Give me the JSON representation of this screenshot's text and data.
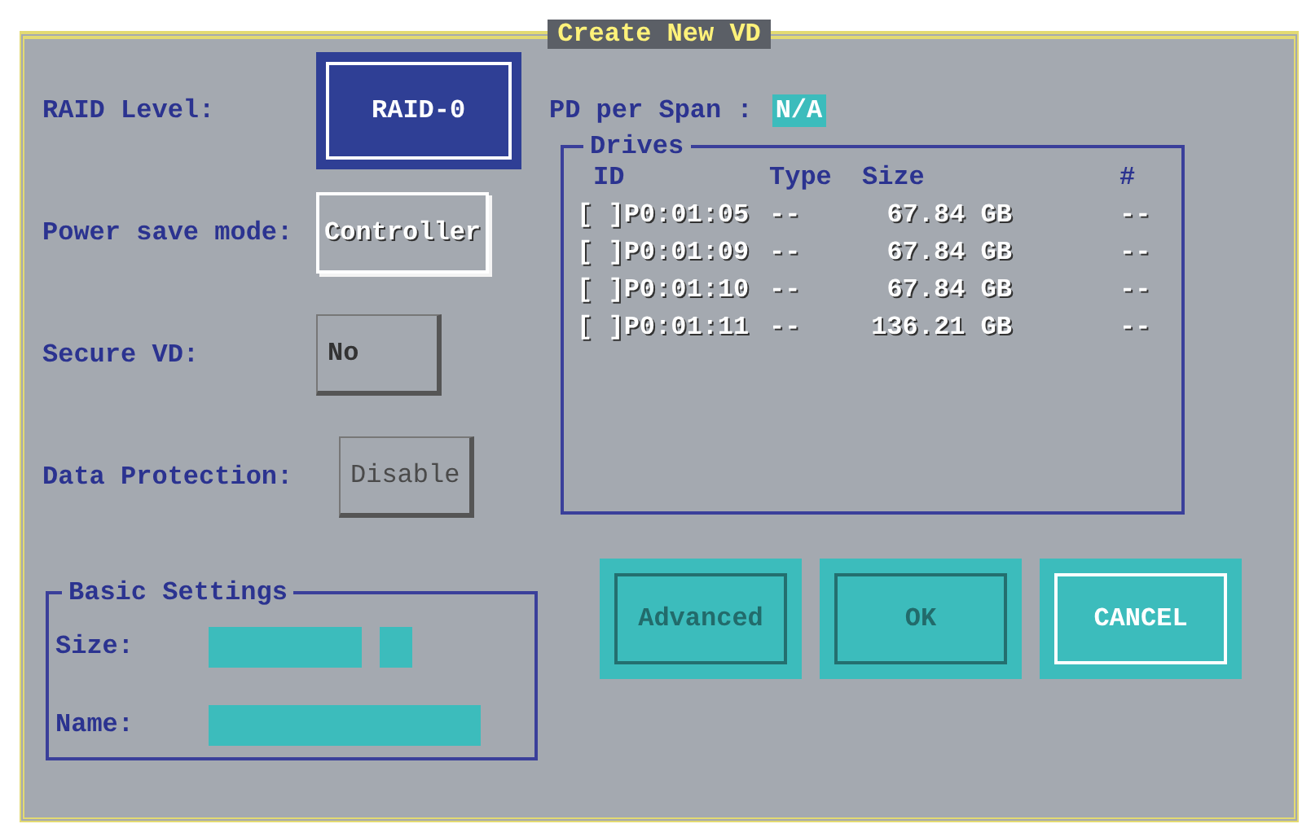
{
  "window": {
    "title": "Create New VD"
  },
  "settings": [
    {
      "label": "RAID Level:",
      "value": "RAID-0",
      "focused": true,
      "highlighted": false,
      "disabled": false
    },
    {
      "label": "Power save mode:",
      "value": "Controller",
      "focused": false,
      "highlighted": true,
      "disabled": false
    },
    {
      "label": "Secure VD:",
      "value": "No",
      "focused": false,
      "highlighted": false,
      "disabled": false
    },
    {
      "label": "Data Protection:",
      "value": "Disable",
      "focused": false,
      "highlighted": false,
      "disabled": true
    }
  ],
  "pd_per_span": {
    "label": "PD per Span :",
    "value": "N/A"
  },
  "drives": {
    "title": "Drives",
    "columns": [
      "ID",
      "Type",
      "Size",
      "#"
    ],
    "rows": [
      {
        "select": "[ ]",
        "checked": false,
        "id": "P0:01:05",
        "type": "--",
        "size": "67.84 GB",
        "number": "--"
      },
      {
        "select": "[ ]",
        "checked": false,
        "id": "P0:01:09",
        "type": "--",
        "size": "67.84 GB",
        "number": "--"
      },
      {
        "select": "[ ]",
        "checked": false,
        "id": "P0:01:10",
        "type": "--",
        "size": "67.84 GB",
        "number": "--"
      },
      {
        "select": "[ ]",
        "checked": false,
        "id": "P0:01:11",
        "type": "--",
        "size": "136.21 GB",
        "number": "--"
      }
    ]
  },
  "basic_settings": {
    "title": "Basic Settings",
    "fields": [
      {
        "label": "Size:",
        "kind": "size"
      },
      {
        "label": "Name:",
        "kind": "text"
      }
    ]
  },
  "buttons": [
    {
      "label": "Advanced",
      "focused": false
    },
    {
      "label": "OK",
      "focused": false
    },
    {
      "label": "CANCEL",
      "focused": true
    }
  ]
}
